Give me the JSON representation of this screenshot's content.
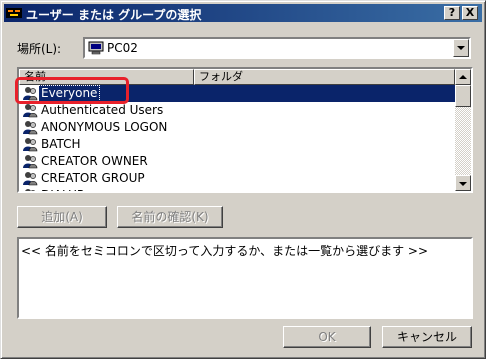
{
  "window": {
    "title": "ユーザー または グループの選択",
    "help_label": "?",
    "close_label": "X"
  },
  "location": {
    "label": "場所(L):",
    "value": "PC02"
  },
  "list": {
    "columns": [
      "名前",
      "フォルダ"
    ],
    "items": [
      {
        "name": "Everyone",
        "selected": true
      },
      {
        "name": "Authenticated Users"
      },
      {
        "name": "ANONYMOUS LOGON"
      },
      {
        "name": "BATCH"
      },
      {
        "name": "CREATOR OWNER"
      },
      {
        "name": "CREATOR GROUP"
      },
      {
        "name": "DIALUP"
      }
    ]
  },
  "buttons": {
    "add": "追加(A)",
    "check_names": "名前の確認(K)",
    "ok": "OK",
    "cancel": "キャンセル"
  },
  "input": {
    "placeholder": "<< 名前をセミコロンで区切って入力するか、または一覧から選びます >>"
  },
  "colors": {
    "selection": "#0a246a",
    "annotation": "#e8212b"
  }
}
